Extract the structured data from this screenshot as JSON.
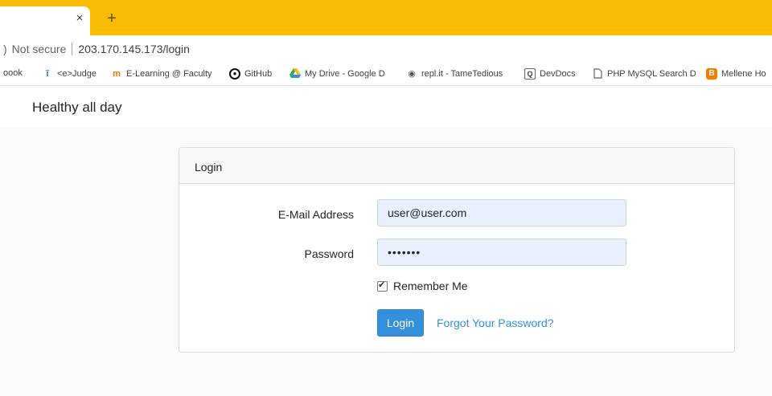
{
  "browser": {
    "tab": {
      "close_glyph": "×"
    },
    "new_tab_glyph": "+",
    "address": {
      "security_text": "Not secure",
      "url": "203.170.145.173/login"
    },
    "bookmarks": [
      {
        "label": "oook",
        "icon": "facebook-icon"
      },
      {
        "label": "<e>Judge",
        "icon": "ejudge-icon"
      },
      {
        "label": "E-Learning @ Faculty",
        "icon": "elearning-icon"
      },
      {
        "label": "GitHub",
        "icon": "github-icon"
      },
      {
        "label": "My Drive - Google D",
        "icon": "google-drive-icon"
      },
      {
        "label": "repl.it - TameTedious",
        "icon": "replit-icon"
      },
      {
        "label": "DevDocs",
        "icon": "devdocs-icon"
      },
      {
        "label": "PHP MySQL Search D",
        "icon": "page-icon"
      },
      {
        "label": "Mellene Ho",
        "icon": "blogger-icon"
      }
    ]
  },
  "navbar": {
    "brand": "Healthy all day"
  },
  "login_card": {
    "header": "Login",
    "email_label": "E-Mail Address",
    "email_value": "user@user.com",
    "password_label": "Password",
    "password_value": "•••••••",
    "remember_label": "Remember Me",
    "remember_checked": true,
    "login_button": "Login",
    "forgot_link": "Forgot Your Password?"
  },
  "colors": {
    "tab_strip": "#fbbc05",
    "primary": "#3490dc",
    "autofill": "#e8f0fe",
    "page_bg": "#f8fafc"
  }
}
